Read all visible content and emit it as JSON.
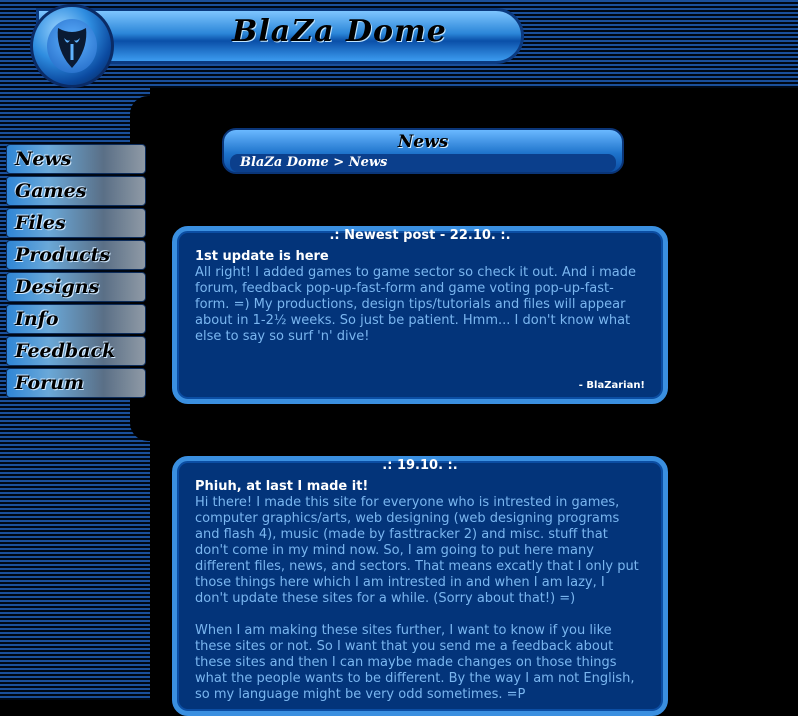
{
  "header": {
    "site_title": "BlaZa Dome",
    "logo_icon": "mask-emblem-icon"
  },
  "nav": {
    "items": [
      {
        "label": "News"
      },
      {
        "label": "Games"
      },
      {
        "label": "Files"
      },
      {
        "label": "Products"
      },
      {
        "label": "Designs"
      },
      {
        "label": "Info"
      },
      {
        "label": "Feedback"
      },
      {
        "label": "Forum"
      }
    ]
  },
  "breadcrumb": {
    "title": "News",
    "path": "BlaZa Dome > News"
  },
  "posts": [
    {
      "header": ".: Newest post - 22.10. :.",
      "title": "1st update is here",
      "paragraphs": [
        "All right! I added games to game sector so check it out. And i made forum, feedback pop-up-fast-form and game voting pop-up-fast-form. =) My productions, design tips/tutorials and files will appear about in 1-2½ weeks. So just be patient. Hmm... I don't know what else to say so surf 'n' dive!"
      ],
      "signature": "- BlaZarian!"
    },
    {
      "header": ".: 19.10. :.",
      "title": "Phiuh, at last I made it!",
      "paragraphs": [
        "Hi there! I made this site for everyone who is intrested in games, computer graphics/arts, web designing (web designing programs and flash 4), music (made by fasttracker 2) and misc. stuff that don't come in my mind now. So, I am going to put here many different files, news, and sectors. That means excatly that I only put those things here which I am intrested in and when I am lazy, I don't update these sites for a while. (Sorry about that!) =)",
        "When I am making these sites further, I want to know if you like these sites or not. So I want that you send me a feedback about these sites and then I can maybe made changes on those things what the people wants to be different. By the way I am not English, so my language might be very odd sometimes. =P"
      ]
    }
  ],
  "colors": {
    "accent": "#3a8fe0",
    "post_bg": "#03347a",
    "post_text": "#7ab6f0"
  }
}
